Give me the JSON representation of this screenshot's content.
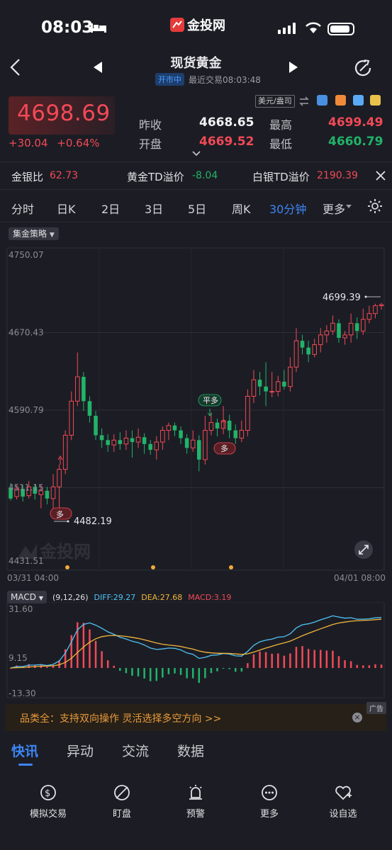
{
  "status_bar": {
    "time": "08:03",
    "app_logo_text": "金投网"
  },
  "header": {
    "title": "现货黄金",
    "market_status": "开市中",
    "last_trade": "最近交易08:03:48"
  },
  "quote": {
    "price": "4698.69",
    "change": "+30.04",
    "change_pct": "+0.64%",
    "prev_close_label": "昨收",
    "prev_close": "4668.65",
    "open_label": "开盘",
    "open": "4669.52",
    "high_label": "最高",
    "high": "4699.49",
    "low_label": "最低",
    "low": "4660.79",
    "unit": "美元/盎司"
  },
  "spreads": {
    "gold_silver_ratio_label": "金银比",
    "gold_silver_ratio": "62.73",
    "gold_td_label": "黄金TD溢价",
    "gold_td": "-8.04",
    "silver_td_label": "白银TD溢价",
    "silver_td": "2190.39"
  },
  "tabs": [
    "分时",
    "日K",
    "2日",
    "3日",
    "5日",
    "周K",
    "30分钟",
    "更多"
  ],
  "active_tab": "30分钟",
  "strategy_label": "集金策略",
  "chart_data": {
    "type": "candlestick",
    "y_ticks": [
      "4750.07",
      "4670.43",
      "4590.79",
      "4511.15",
      "4431.51"
    ],
    "x_ticks": [
      "03/31 04:00",
      "04/01 08:00"
    ],
    "ylim": [
      4431.51,
      4750.07
    ],
    "max_label": "4699.39",
    "min_label": "4482.19",
    "signals": [
      "多",
      "平多",
      "多"
    ],
    "watermark": "金投网",
    "candles": [
      [
        4511,
        4500,
        4516,
        4498
      ],
      [
        4502,
        4510,
        4514,
        4499
      ],
      [
        4510,
        4502,
        4514,
        4497
      ],
      [
        4503,
        4512,
        4518,
        4500
      ],
      [
        4512,
        4505,
        4515,
        4499
      ],
      [
        4504,
        4508,
        4514,
        4490
      ],
      [
        4508,
        4500,
        4512,
        4494
      ],
      [
        4500,
        4512,
        4525,
        4490
      ],
      [
        4512,
        4530,
        4535,
        4488
      ],
      [
        4530,
        4565,
        4570,
        4525
      ],
      [
        4565,
        4600,
        4610,
        4560
      ],
      [
        4600,
        4625,
        4650,
        4595
      ],
      [
        4625,
        4600,
        4630,
        4590
      ],
      [
        4600,
        4585,
        4605,
        4578
      ],
      [
        4585,
        4565,
        4590,
        4560
      ],
      [
        4565,
        4560,
        4572,
        4552
      ],
      [
        4560,
        4555,
        4566,
        4548
      ],
      [
        4555,
        4560,
        4566,
        4548
      ],
      [
        4560,
        4556,
        4568,
        4550
      ],
      [
        4556,
        4562,
        4570,
        4550
      ],
      [
        4562,
        4558,
        4570,
        4542
      ],
      [
        4558,
        4563,
        4572,
        4552
      ],
      [
        4563,
        4556,
        4567,
        4546
      ],
      [
        4556,
        4550,
        4560,
        4545
      ],
      [
        4550,
        4558,
        4564,
        4540
      ],
      [
        4558,
        4570,
        4574,
        4550
      ],
      [
        4570,
        4575,
        4578,
        4560
      ],
      [
        4575,
        4570,
        4578,
        4564
      ],
      [
        4570,
        4562,
        4574,
        4556
      ],
      [
        4562,
        4552,
        4566,
        4546
      ],
      [
        4552,
        4560,
        4570,
        4548
      ],
      [
        4560,
        4540,
        4565,
        4528
      ],
      [
        4540,
        4570,
        4585,
        4535
      ],
      [
        4570,
        4578,
        4588,
        4565
      ],
      [
        4578,
        4572,
        4582,
        4564
      ],
      [
        4572,
        4580,
        4595,
        4566
      ],
      [
        4580,
        4570,
        4586,
        4562
      ],
      [
        4570,
        4562,
        4576,
        4556
      ],
      [
        4562,
        4570,
        4580,
        4558
      ],
      [
        4570,
        4605,
        4612,
        4564
      ],
      [
        4605,
        4622,
        4632,
        4598
      ],
      [
        4622,
        4615,
        4630,
        4606
      ],
      [
        4615,
        4610,
        4640,
        4595
      ],
      [
        4610,
        4610,
        4630,
        4604
      ],
      [
        4610,
        4620,
        4626,
        4605
      ],
      [
        4620,
        4615,
        4632,
        4612
      ],
      [
        4615,
        4635,
        4645,
        4610
      ],
      [
        4635,
        4662,
        4675,
        4630
      ],
      [
        4662,
        4655,
        4668,
        4648
      ],
      [
        4655,
        4648,
        4662,
        4640
      ],
      [
        4648,
        4658,
        4664,
        4645
      ],
      [
        4658,
        4668,
        4675,
        4650
      ],
      [
        4668,
        4672,
        4678,
        4660
      ],
      [
        4672,
        4680,
        4688,
        4668
      ],
      [
        4680,
        4665,
        4684,
        4660
      ],
      [
        4665,
        4668,
        4672,
        4658
      ],
      [
        4668,
        4680,
        4690,
        4660
      ],
      [
        4680,
        4672,
        4686,
        4664
      ],
      [
        4672,
        4684,
        4695,
        4668
      ],
      [
        4684,
        4690,
        4698,
        4680
      ],
      [
        4690,
        4698,
        4700,
        4685
      ],
      [
        4698,
        4699,
        4701,
        4694
      ]
    ]
  },
  "macd": {
    "selector": "MACD",
    "params": "(9,12,26)",
    "diff": "DIFF:29.27",
    "dea": "DEA:27.68",
    "macd": "MACD:3.19",
    "y_ticks": [
      "31.60",
      "9.15",
      "-13.30"
    ],
    "colors": {
      "diff": "#4fc3f7",
      "dea": "#f2b53c",
      "bar_up": "#f24957",
      "bar_down": "#21b36a"
    }
  },
  "ad": {
    "text": "品类全：支持双向操作 灵活选择多空方向 >>",
    "tag": "广告"
  },
  "news_tabs": [
    "快讯",
    "异动",
    "交流",
    "数据"
  ],
  "news_active": "快讯",
  "bottom_nav": [
    "模拟交易",
    "盯盘",
    "预警",
    "更多",
    "设自选"
  ]
}
